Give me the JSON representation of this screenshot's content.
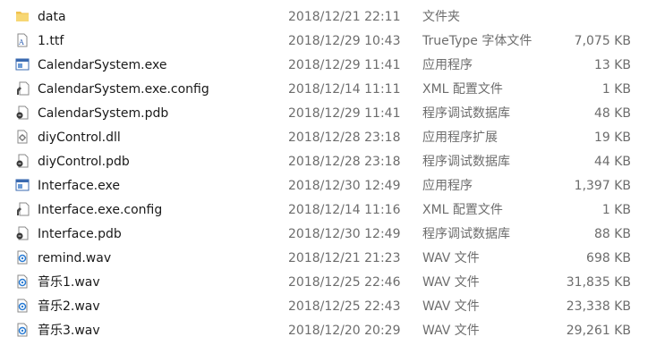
{
  "files": [
    {
      "icon": "folder-icon",
      "name": "data",
      "date": "2018/12/21 22:11",
      "type": "文件夹",
      "size": ""
    },
    {
      "icon": "font-file-icon",
      "name": "1.ttf",
      "date": "2018/12/29 10:43",
      "type": "TrueType 字体文件",
      "size": "7,075 KB"
    },
    {
      "icon": "exe-icon",
      "name": "CalendarSystem.exe",
      "date": "2018/12/29 11:41",
      "type": "应用程序",
      "size": "13 KB"
    },
    {
      "icon": "config-file-icon",
      "name": "CalendarSystem.exe.config",
      "date": "2018/12/14 11:11",
      "type": "XML 配置文件",
      "size": "1 KB"
    },
    {
      "icon": "pdb-file-icon",
      "name": "CalendarSystem.pdb",
      "date": "2018/12/29 11:41",
      "type": "程序调试数据库",
      "size": "48 KB"
    },
    {
      "icon": "dll-file-icon",
      "name": "diyControl.dll",
      "date": "2018/12/28 23:18",
      "type": "应用程序扩展",
      "size": "19 KB"
    },
    {
      "icon": "pdb-file-icon",
      "name": "diyControl.pdb",
      "date": "2018/12/28 23:18",
      "type": "程序调试数据库",
      "size": "44 KB"
    },
    {
      "icon": "exe-icon",
      "name": "Interface.exe",
      "date": "2018/12/30 12:49",
      "type": "应用程序",
      "size": "1,397 KB"
    },
    {
      "icon": "config-file-icon",
      "name": "Interface.exe.config",
      "date": "2018/12/14 11:16",
      "type": "XML 配置文件",
      "size": "1 KB"
    },
    {
      "icon": "pdb-file-icon",
      "name": "Interface.pdb",
      "date": "2018/12/30 12:49",
      "type": "程序调试数据库",
      "size": "88 KB"
    },
    {
      "icon": "audio-file-icon",
      "name": "remind.wav",
      "date": "2018/12/21 21:23",
      "type": "WAV 文件",
      "size": "698 KB"
    },
    {
      "icon": "audio-file-icon",
      "name": "音乐1.wav",
      "date": "2018/12/25 22:46",
      "type": "WAV 文件",
      "size": "31,835 KB"
    },
    {
      "icon": "audio-file-icon",
      "name": "音乐2.wav",
      "date": "2018/12/25 22:43",
      "type": "WAV 文件",
      "size": "23,338 KB"
    },
    {
      "icon": "audio-file-icon",
      "name": "音乐3.wav",
      "date": "2018/12/20 20:29",
      "type": "WAV 文件",
      "size": "29,261 KB"
    }
  ]
}
